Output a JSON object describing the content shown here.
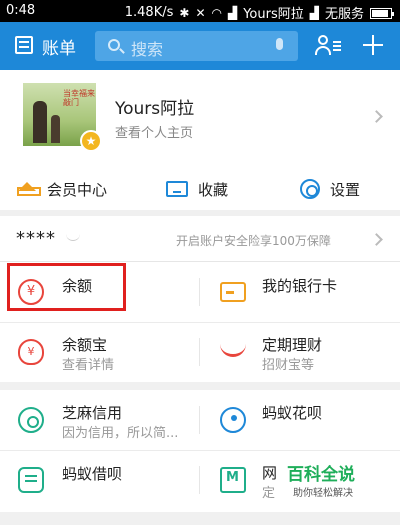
{
  "status_bar": {
    "time": "0:48",
    "speed": "1.48K/s",
    "carrier": "Yours阿拉",
    "network": "无服务"
  },
  "header": {
    "title": "账单",
    "search_placeholder": "搜索",
    "icons": [
      "bill-icon",
      "search-icon",
      "mic-icon",
      "contacts-icon",
      "plus-icon"
    ]
  },
  "profile": {
    "name": "Yours阿拉",
    "link": "查看个人主页",
    "avatar_text": "当幸福来敲门"
  },
  "quick_actions": [
    {
      "label": "会员中心",
      "icon": "crown-icon"
    },
    {
      "label": "收藏",
      "icon": "tray-icon"
    },
    {
      "label": "设置",
      "icon": "gear-icon"
    }
  ],
  "assets": {
    "masked_balance": "****",
    "promo": "开启账户安全险享100万保障"
  },
  "grid1": [
    {
      "label": "余额",
      "sub": "",
      "icon": "yen-icon"
    },
    {
      "label": "我的银行卡",
      "sub": "",
      "icon": "bank-card-icon"
    },
    {
      "label": "余额宝",
      "sub": "查看详情",
      "icon": "money-bag-icon"
    },
    {
      "label": "定期理财",
      "sub": "招财宝等",
      "icon": "wealth-wave-icon"
    }
  ],
  "grid2": [
    {
      "label": "芝麻信用",
      "sub": "因为信用，所以简...",
      "icon": "sesame-icon"
    },
    {
      "label": "蚂蚁花呗",
      "sub": "",
      "icon": "huabei-icon"
    },
    {
      "label": "蚂蚁借呗",
      "sub": "",
      "icon": "jiebei-icon"
    },
    {
      "label": "网",
      "sub": "定",
      "icon": "mybank-icon"
    }
  ],
  "watermark": {
    "title": "百科全说",
    "subtitle": "助你轻松解决"
  },
  "colors": {
    "header_blue": "#1e88d8",
    "highlight_red": "#e0201e",
    "accent_orange": "#f0a020",
    "accent_green": "#1fae8a"
  }
}
